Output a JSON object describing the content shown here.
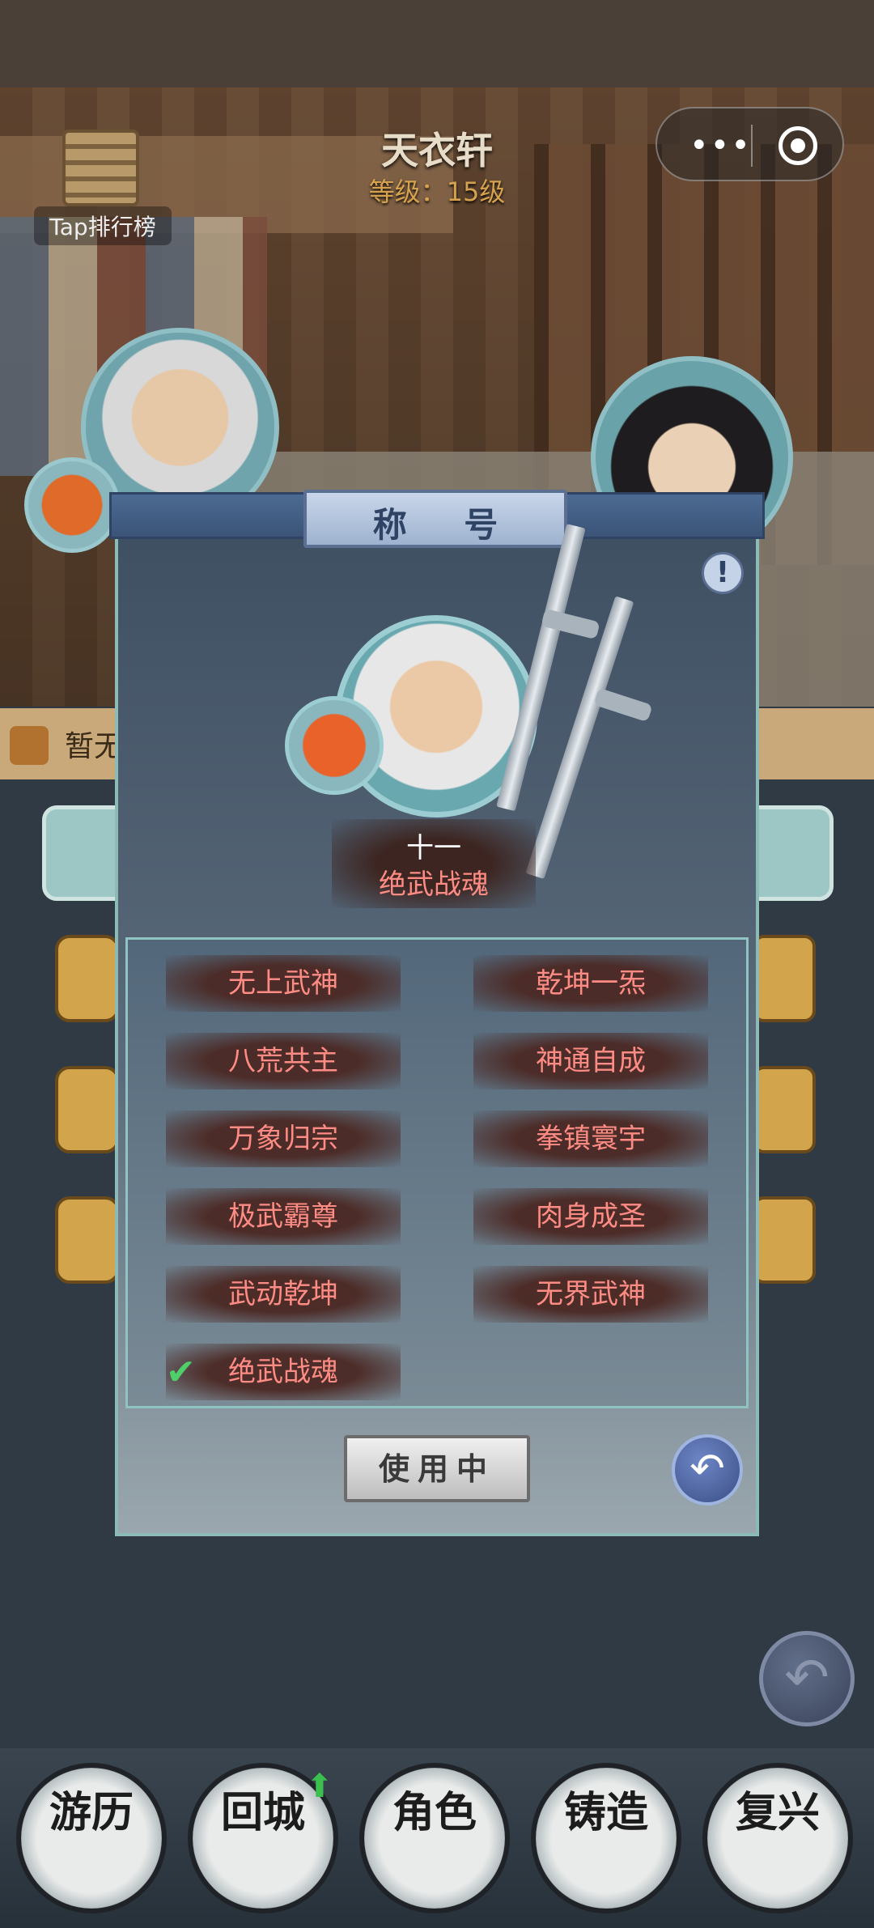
{
  "header": {
    "shop_title": "天衣轩",
    "shop_level": "等级：15级"
  },
  "miniprogram_capsule": {
    "menu_icon": "more-dots-icon",
    "close_icon": "target-icon"
  },
  "rank_button": {
    "label": "Tap排行榜"
  },
  "task_bar": {
    "text": "暂无"
  },
  "modal": {
    "title": "称 号",
    "info_label": "!",
    "current_rank": "十一",
    "current_title": "绝武战魂",
    "titles": [
      "无上武神",
      "乾坤一炁",
      "八荒共主",
      "神通自成",
      "万象归宗",
      "拳镇寰宇",
      "极武霸尊",
      "肉身成圣",
      "武动乾坤",
      "无界武神",
      "绝武战魂"
    ],
    "selected_index": 10,
    "check_mark": "✔",
    "use_button_label": "使用中",
    "back_icon": "↶"
  },
  "page_back_icon": "↶",
  "bottom_nav": {
    "items": [
      {
        "label": "游历"
      },
      {
        "label": "回城"
      },
      {
        "label": "角色"
      },
      {
        "label": "铸造"
      },
      {
        "label": "复兴"
      }
    ],
    "upgrade_arrow": "⬆"
  }
}
